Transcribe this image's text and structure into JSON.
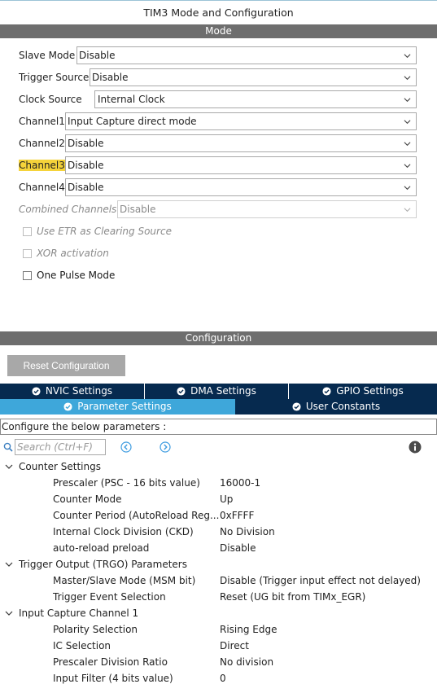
{
  "window": {
    "title": "TIM3 Mode and Configuration"
  },
  "mode_section": {
    "header": "Mode",
    "rows": [
      {
        "label": "Slave Mode",
        "value": "Disable"
      },
      {
        "label": "Trigger Source",
        "value": "Disable"
      },
      {
        "label": "Clock Source",
        "value": "Internal Clock"
      },
      {
        "label": "Channel1",
        "value": "Input Capture direct mode"
      },
      {
        "label": "Channel2",
        "value": "Disable"
      },
      {
        "label": "Channel3",
        "value": "Disable",
        "highlighted": true
      },
      {
        "label": "Channel4",
        "value": "Disable"
      },
      {
        "label": "Combined Channels",
        "value": "Disable",
        "disabled": true
      }
    ],
    "checkboxes": [
      {
        "label": "Use ETR as Clearing Source",
        "checked": false,
        "disabled": true
      },
      {
        "label": "XOR activation",
        "checked": false,
        "disabled": true
      },
      {
        "label": "One Pulse Mode",
        "checked": false,
        "disabled": false
      }
    ]
  },
  "config_section": {
    "header": "Configuration",
    "reset_button": "Reset Configuration",
    "tabs_row1": [
      "NVIC Settings",
      "DMA Settings",
      "GPIO Settings"
    ],
    "tabs_row2": [
      "Parameter Settings",
      "User Constants"
    ],
    "active_tab": "Parameter Settings",
    "description": "Configure the below parameters :",
    "search_placeholder": "Search (Ctrl+F)",
    "groups": [
      {
        "name": "Counter Settings",
        "params": [
          {
            "name": "Prescaler (PSC - 16 bits value)",
            "value": "16000-1"
          },
          {
            "name": "Counter Mode",
            "value": "Up"
          },
          {
            "name": "Counter Period (AutoReload Reg...",
            "value": "0xFFFF"
          },
          {
            "name": "Internal Clock Division (CKD)",
            "value": "No Division"
          },
          {
            "name": "auto-reload preload",
            "value": "Disable"
          }
        ]
      },
      {
        "name": "Trigger Output (TRGO) Parameters",
        "params": [
          {
            "name": "Master/Slave Mode (MSM bit)",
            "value": "Disable (Trigger input effect not delayed)"
          },
          {
            "name": "Trigger Event Selection",
            "value": "Reset (UG bit from TIMx_EGR)"
          }
        ]
      },
      {
        "name": "Input Capture Channel 1",
        "params": [
          {
            "name": "Polarity Selection",
            "value": "Rising Edge"
          },
          {
            "name": "IC Selection",
            "value": "Direct"
          },
          {
            "name": "Prescaler Division Ratio",
            "value": "No division"
          },
          {
            "name": "Input Filter (4 bits value)",
            "value": "0"
          }
        ]
      }
    ]
  },
  "colors": {
    "section_bar": "#6e6e6e",
    "tab_dark": "#062a4f",
    "tab_active": "#3ea7da",
    "highlight": "#f5d33a"
  },
  "icons": [
    "chevron-down-icon",
    "check-circle-icon",
    "search-icon",
    "arrow-left-circle-icon",
    "arrow-right-circle-icon",
    "info-icon",
    "tree-chevron-down-icon"
  ]
}
